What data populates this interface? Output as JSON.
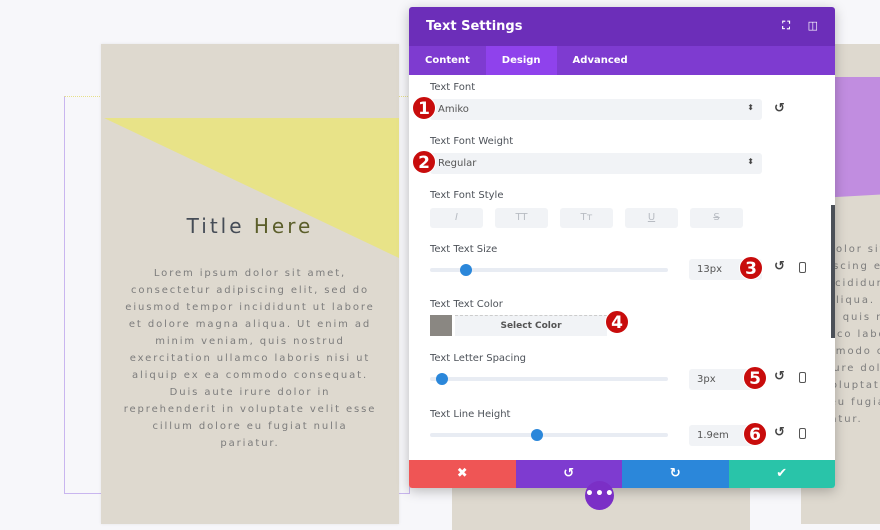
{
  "preview": {
    "title_part1": "Title",
    "title_part2": "Here",
    "body": "Lorem ipsum dolor sit amet, consectetur adipiscing elit, sed do eiusmod tempor incididunt ut labore et dolore magna aliqua. Ut enim ad minim veniam, quis nostrud exercitation ullamco laboris nisi ut aliquip ex ea commodo consequat. Duis aute irure dolor in reprehenderit in voluptate velit esse cillum dolore eu fugiat nulla pariatur.",
    "colors": {
      "card": "#ded9cf",
      "yellow_shape": "#e8e388",
      "purple_shape": "#c18de0"
    }
  },
  "panel": {
    "title": "Text Settings",
    "tabs": [
      {
        "label": "Content"
      },
      {
        "label": "Design",
        "active": true
      },
      {
        "label": "Advanced"
      }
    ],
    "fields": {
      "font": {
        "label": "Text Font",
        "value": "Amiko",
        "badge": "1"
      },
      "weight": {
        "label": "Text Font Weight",
        "value": "Regular",
        "badge": "2"
      },
      "style": {
        "label": "Text Font Style",
        "buttons": [
          "I",
          "TT",
          "Tт",
          "U",
          "S"
        ]
      },
      "size": {
        "label": "Text Text Size",
        "value": "13px",
        "badge": "3",
        "slider_fraction": 0.15
      },
      "color": {
        "label": "Text Text Color",
        "button": "Select Color",
        "swatch": "#8a8782",
        "badge": "4"
      },
      "letter_spacing": {
        "label": "Text Letter Spacing",
        "value": "3px",
        "badge": "5",
        "slider_fraction": 0.05
      },
      "line_height": {
        "label": "Text Line Height",
        "value": "1.9em",
        "badge": "6",
        "slider_fraction": 0.45
      }
    },
    "footer": {
      "cancel": "✖",
      "undo": "↺",
      "redo": "↻",
      "save": "✔"
    },
    "colors": {
      "header": "#6c2eb9",
      "tabs": "#7e3bd0",
      "active_tab": "#8f42ec",
      "cancel": "#ef5555",
      "undo": "#7e3bd0",
      "redo": "#2b87da",
      "save": "#29c4a9"
    }
  },
  "more_button": "•••"
}
